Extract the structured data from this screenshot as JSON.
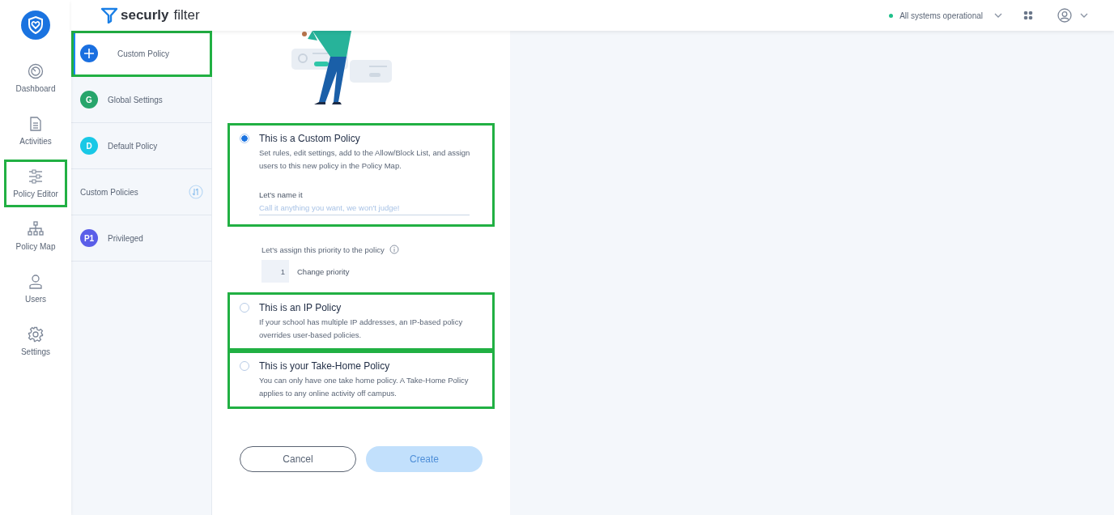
{
  "brand": {
    "word1": "securly",
    "word2": "filter"
  },
  "topbar": {
    "status": {
      "text": "All systems operational",
      "color": "#1fc08a"
    }
  },
  "nav": [
    {
      "label": "Dashboard",
      "kind": "gauge",
      "highlighted": false
    },
    {
      "label": "Activities",
      "kind": "doc",
      "highlighted": false
    },
    {
      "label": "Policy Editor",
      "kind": "sliders",
      "highlighted": true
    },
    {
      "label": "Policy Map",
      "kind": "tree",
      "highlighted": false
    },
    {
      "label": "Users",
      "kind": "user",
      "highlighted": false
    },
    {
      "label": "Settings",
      "kind": "gear",
      "highlighted": false
    }
  ],
  "policy_list": [
    {
      "kind": "new",
      "label": "Custom Policy",
      "color": "#1a6fe0",
      "selected": true,
      "highlighted": true
    },
    {
      "kind": "policy",
      "badge": "G",
      "label": "Global Settings",
      "color": "#27a56b",
      "selected": false,
      "highlighted": false
    },
    {
      "kind": "policy",
      "badge": "D",
      "label": "Default Policy",
      "color": "#19c8e6",
      "selected": false,
      "highlighted": false
    },
    {
      "kind": "section",
      "label": "Custom Policies",
      "selected": false,
      "highlighted": false
    },
    {
      "kind": "policy",
      "badge": "P1",
      "label": "Privileged",
      "color": "#5a5ee8",
      "selected": false,
      "highlighted": false
    }
  ],
  "options": [
    {
      "title": "This is a Custom Policy",
      "description": "Set rules, edit settings, add to the Allow/Block List, and assign users to this new policy in the Policy Map.",
      "selected": true,
      "highlighted": true,
      "name_field": {
        "label": "Let's name it",
        "placeholder": "Call it anything you want, we won't judge!"
      },
      "priority": {
        "label": "Let's assign this priority to the policy",
        "value": "1",
        "link": "Change priority"
      }
    },
    {
      "title": "This is an IP Policy",
      "description": "If your school has multiple IP addresses, an IP-based policy overrides user-based policies.",
      "selected": false,
      "highlighted": true
    },
    {
      "title": "This is your Take-Home Policy",
      "description": "You can only have one take home policy. A Take-Home Policy applies to any online activity off campus.",
      "selected": false,
      "highlighted": true
    }
  ],
  "buttons": [
    {
      "label": "Cancel",
      "kind": "secondary"
    },
    {
      "label": "Create",
      "kind": "primary",
      "disabled": true
    }
  ]
}
